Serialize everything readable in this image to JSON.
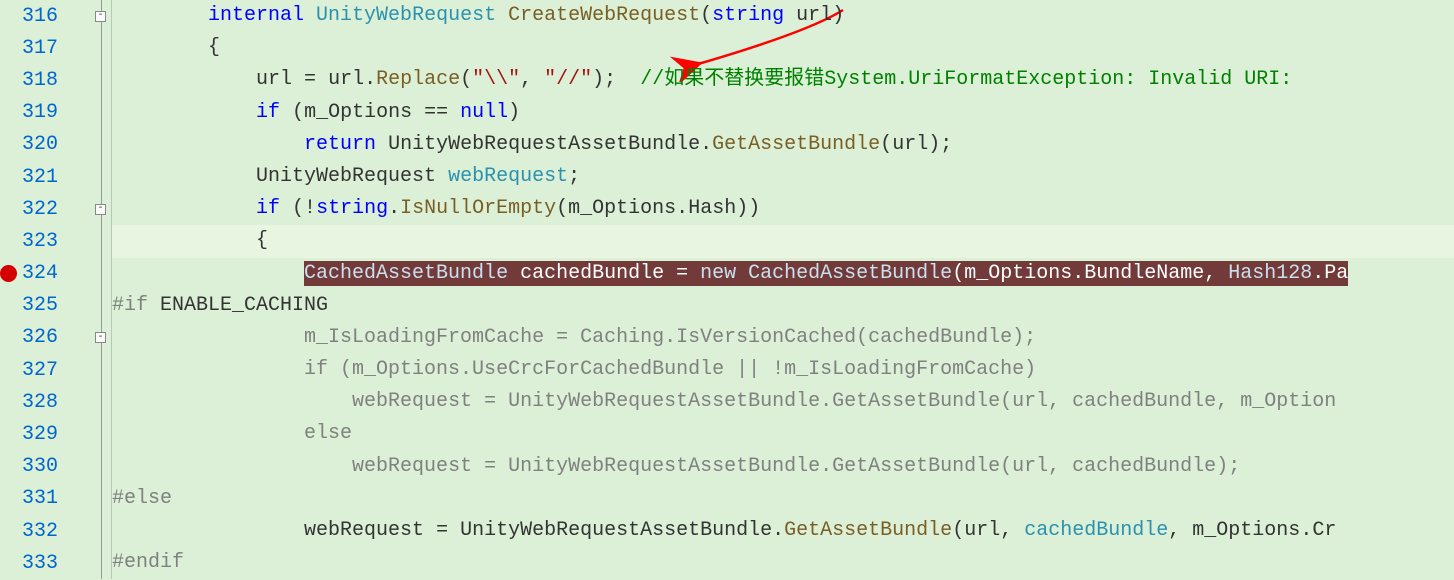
{
  "lines": {
    "316": {
      "num": "316",
      "indent": "        ",
      "parts": [
        {
          "t": "internal",
          "cls": "k"
        },
        {
          "t": " ",
          "cls": "p"
        },
        {
          "t": "UnityWebRequest",
          "cls": "t"
        },
        {
          "t": " ",
          "cls": "p"
        },
        {
          "t": "CreateWebRequest",
          "cls": "m"
        },
        {
          "t": "(",
          "cls": "p"
        },
        {
          "t": "string",
          "cls": "k"
        },
        {
          "t": " ",
          "cls": "p"
        },
        {
          "t": "url",
          "cls": "id"
        },
        {
          "t": ")",
          "cls": "p"
        }
      ]
    },
    "317": {
      "num": "317",
      "indent": "        ",
      "parts": [
        {
          "t": "{",
          "cls": "p"
        }
      ]
    },
    "318": {
      "num": "318",
      "indent": "            ",
      "parts": [
        {
          "t": "url",
          "cls": "id"
        },
        {
          "t": " = ",
          "cls": "p"
        },
        {
          "t": "url",
          "cls": "id"
        },
        {
          "t": ".",
          "cls": "p"
        },
        {
          "t": "Replace",
          "cls": "m"
        },
        {
          "t": "(",
          "cls": "p"
        },
        {
          "t": "\"\\\\\"",
          "cls": "s"
        },
        {
          "t": ", ",
          "cls": "p"
        },
        {
          "t": "\"//\"",
          "cls": "s"
        },
        {
          "t": ");  ",
          "cls": "p"
        },
        {
          "t": "//如果不替换要报错System.UriFormatException: Invalid URI: ",
          "cls": "c"
        }
      ]
    },
    "319": {
      "num": "319",
      "indent": "            ",
      "parts": [
        {
          "t": "if",
          "cls": "k"
        },
        {
          "t": " (",
          "cls": "p"
        },
        {
          "t": "m_Options",
          "cls": "id"
        },
        {
          "t": " == ",
          "cls": "p"
        },
        {
          "t": "null",
          "cls": "k"
        },
        {
          "t": ")",
          "cls": "p"
        }
      ]
    },
    "320": {
      "num": "320",
      "indent": "                ",
      "parts": [
        {
          "t": "return",
          "cls": "k"
        },
        {
          "t": " ",
          "cls": "p"
        },
        {
          "t": "UnityWebRequestAssetBundle",
          "cls": "id"
        },
        {
          "t": ".",
          "cls": "p"
        },
        {
          "t": "GetAssetBundle",
          "cls": "m"
        },
        {
          "t": "(",
          "cls": "p"
        },
        {
          "t": "url",
          "cls": "id"
        },
        {
          "t": ");",
          "cls": "p"
        }
      ]
    },
    "321": {
      "num": "321",
      "indent": "            ",
      "parts": [
        {
          "t": "UnityWebRequest",
          "cls": "id"
        },
        {
          "t": " ",
          "cls": "p"
        },
        {
          "t": "webRequest",
          "cls": "t"
        },
        {
          "t": ";",
          "cls": "p"
        }
      ]
    },
    "322": {
      "num": "322",
      "indent": "            ",
      "parts": [
        {
          "t": "if",
          "cls": "k"
        },
        {
          "t": " (!",
          "cls": "p"
        },
        {
          "t": "string",
          "cls": "k"
        },
        {
          "t": ".",
          "cls": "p"
        },
        {
          "t": "IsNullOrEmpty",
          "cls": "m"
        },
        {
          "t": "(",
          "cls": "p"
        },
        {
          "t": "m_Options",
          "cls": "id"
        },
        {
          "t": ".",
          "cls": "p"
        },
        {
          "t": "Hash",
          "cls": "id"
        },
        {
          "t": "))",
          "cls": "p"
        }
      ]
    },
    "323": {
      "num": "323",
      "indent": "            ",
      "parts": [
        {
          "t": "{",
          "cls": "p"
        }
      ]
    },
    "324": {
      "num": "324",
      "indent": "                ",
      "selected": [
        {
          "t": "CachedAssetBundle",
          "cls": "sel-t"
        },
        {
          "t": " cachedBundle = ",
          "cls": "sel-w"
        },
        {
          "t": "new",
          "cls": "sel-t"
        },
        {
          "t": " ",
          "cls": "sel-w"
        },
        {
          "t": "CachedAssetBundle",
          "cls": "sel-t"
        },
        {
          "t": "(m_Options.BundleName, ",
          "cls": "sel-w"
        },
        {
          "t": "Hash128",
          "cls": "sel-t"
        },
        {
          "t": ".Pa",
          "cls": "sel-w"
        }
      ]
    },
    "325": {
      "num": "325",
      "indent": "",
      "parts": [
        {
          "t": "#if",
          "cls": "dim"
        },
        {
          "t": " ENABLE_CACHING",
          "cls": "id"
        }
      ]
    },
    "326": {
      "num": "326",
      "indent": "                ",
      "parts": [
        {
          "t": "m_IsLoadingFromCache = Caching.IsVersionCached(cachedBundle);",
          "cls": "dim"
        }
      ]
    },
    "327": {
      "num": "327",
      "indent": "                ",
      "parts": [
        {
          "t": "if (m_Options.UseCrcForCachedBundle || !m_IsLoadingFromCache)",
          "cls": "dim"
        }
      ]
    },
    "328": {
      "num": "328",
      "indent": "                    ",
      "parts": [
        {
          "t": "webRequest = UnityWebRequestAssetBundle.GetAssetBundle(url, cachedBundle, m_Option",
          "cls": "dim"
        }
      ]
    },
    "329": {
      "num": "329",
      "indent": "                ",
      "parts": [
        {
          "t": "else",
          "cls": "dim"
        }
      ]
    },
    "330": {
      "num": "330",
      "indent": "                    ",
      "parts": [
        {
          "t": "webRequest = UnityWebRequestAssetBundle.GetAssetBundle(url, cachedBundle);",
          "cls": "dim"
        }
      ]
    },
    "331": {
      "num": "331",
      "indent": "",
      "parts": [
        {
          "t": "#else",
          "cls": "dim"
        }
      ]
    },
    "332": {
      "num": "332",
      "indent": "                ",
      "parts": [
        {
          "t": "webRequest",
          "cls": "id"
        },
        {
          "t": " = ",
          "cls": "p"
        },
        {
          "t": "UnityWebRequestAssetBundle",
          "cls": "id"
        },
        {
          "t": ".",
          "cls": "p"
        },
        {
          "t": "GetAssetBundle",
          "cls": "m"
        },
        {
          "t": "(",
          "cls": "p"
        },
        {
          "t": "url",
          "cls": "id"
        },
        {
          "t": ", ",
          "cls": "p"
        },
        {
          "t": "cachedBundle",
          "cls": "t"
        },
        {
          "t": ", ",
          "cls": "p"
        },
        {
          "t": "m_Options",
          "cls": "id"
        },
        {
          "t": ".",
          "cls": "p"
        },
        {
          "t": "Cr",
          "cls": "id"
        }
      ]
    },
    "333": {
      "num": "333",
      "indent": "",
      "parts": [
        {
          "t": "#endif",
          "cls": "dim"
        }
      ]
    }
  },
  "fold": {
    "316": "-",
    "322": "-",
    "326": "-"
  },
  "breakpoint_line": "324"
}
